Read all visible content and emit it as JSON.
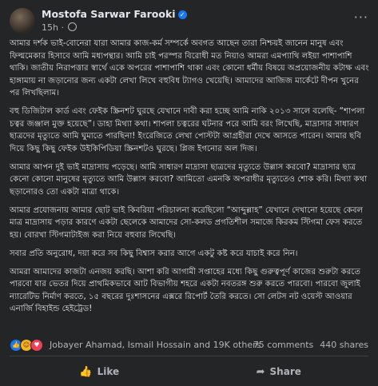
{
  "post": {
    "author": "Mostofa Sarwar Farooki",
    "time": "15h",
    "paragraphs": [
      "আমার দর্শক ভাই-বোনেরা যারা আমার কাজ-কর্ম সম্পর্কে অবগত আছেন তারা নিশ্চয়ই জানেন মানুষ এবং ফিল্মমেকার হিসাবে আমি মধ্যপন্থার। আমি চাই পরস্পর বিরোধী মত নিয়াও আমরা এমপ্যাথি লইয়া পাশাপাশি থাকি। জাতীয় নিরাপত্তার স্বার্থে একে অপরের পাশাপাশি থাকা এবং কোনো ধর্মীয় বিষয়ে অপ্রয়োজনীয় কটাক্ষ এবং হাঙ্গামায় না জড়ানোর জন্য একটা লেখা লিখে বহুবিধ ট্যাগও খেয়েছি। আমাদের আজিজ মার্কেটে দীপন খুনের পর লিখছিলাম।",
      "বহু ডিজিটাল কার্ড এবং ফেইক স্ক্রিনশট ঘুরছে যেখানে দাবী করা হচ্ছে আমি নাকি ২০১৩ সালে বলেছি- “শাপলা চত্বর জঞ্জাল মুক্ত হয়েছে”। ডাহা মিথ্যা কথা। শাপলা চত্বরের ঘটনার পরে আমি বরং লিখেছি, মাদ্রাসার সাধারণ ছাত্রদের মৃত্যুতে আমি ঘুমাতে পারছিনা! ইংরেজিতে লেখা পোস্টটা আগ্রহীরা দেখে আসতে পারেন। আমার ছবি দিয়ে কিছু কিছু ফেইক উইকিপিডিয়া স্ক্রিনশটও ঘুরছে। প্লিজ ইগনোর অল দিজ।",
      "আমার আপন দুই ভাই মাদ্রাসায় পড়েছে। আমি সাধারণ মাদ্রাসা ছাত্রদের মৃত্যুতে উল্লাস করবো? মাদ্রাসার ছাত্র কেনো কোনো মানুষের মৃত্যুতে আমি উল্লাস করবো? আমিতো এমনকি অপরাধীর মৃত্যুতেও শোক করি। মিথ্যা কথা ছড়ানোরও তো একটা মাত্রা থাকে।",
      "আমার প্রযোজনায় আমার ছোট ভাই কিবরিয়া পরিচালনা করেছিলো “আব্দুল্লাহ” যেখানে দেখানো হয়েছে কেবল মাত্র মাদ্রাসায় পড়ার কারণে একটা ছেলেকে আমাদের সো-কলড প্রগতিশীল সমাজে কিরকম স্টিগমা ফেস করতে হয়। বোরখা স্টিগমাটাইজ করা নিয়ে বহুবার লিখেছি।",
      "সবার প্রতি অনুরোধ, দয়া করে সব কিছু বিশ্বাস করার আগে একটু কষ্ট করে যাচাই করে নিন।",
      "আমরা আমাদের কাজটা এনজয় করছি। আশা করি আগামী সপ্তাহের মধ্যে কিছু গুরুত্বপূর্ণ কাজের শুরুটা করতে পারবো যার ভেতর দিয়ে প্রাথমিকভাবে আট বিভাগীয় শহরে একটা নবতরঙ্গ শুরু করতে পারবো। পারবো জুলাই ন্যারেটিভ নির্মাণ করতে, ১৫ বছরের দুঃশাসনের এক্সরে রিপোর্ট তৈরি করতে। সো লেটস নট ওয়েস্ট আওয়ার এনার্জি বিহাইন্ড হেইট্রেড!"
    ]
  },
  "stats": {
    "reacted_by": "Jobayer Ahamad, Ismail Hossain and 19K others",
    "comments": "75 comments",
    "shares": "440 shares"
  },
  "actions": {
    "like": "Like",
    "share": "Share"
  }
}
